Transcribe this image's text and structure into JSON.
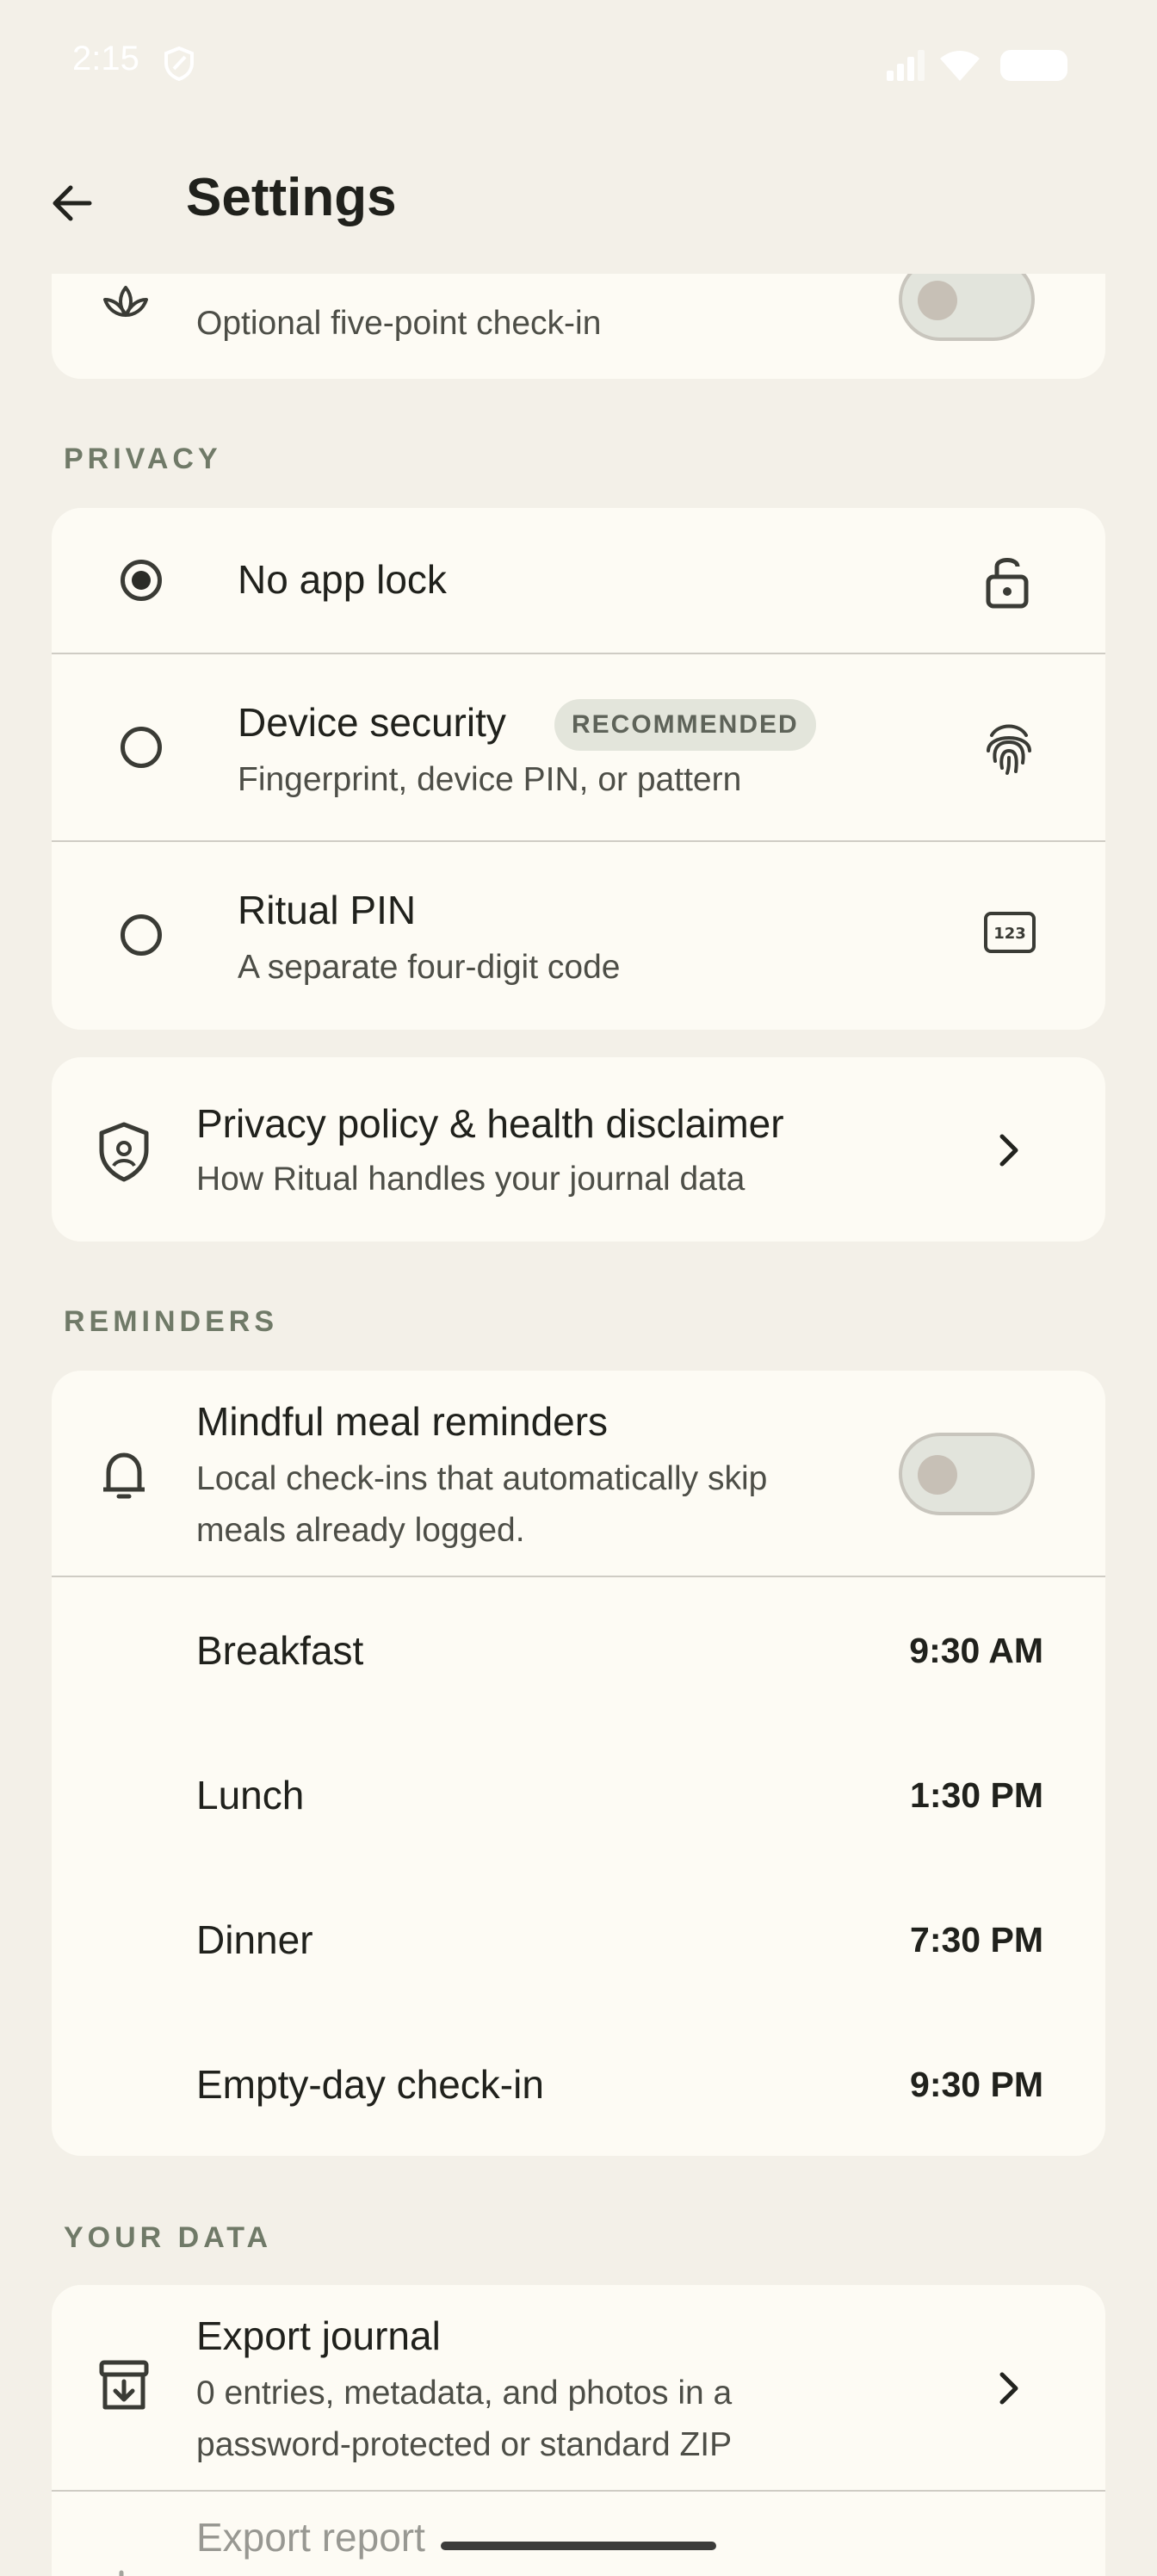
{
  "status_bar": {
    "time": "2:15"
  },
  "app_bar": {
    "title": "Settings"
  },
  "top_card": {
    "subtitle": "Optional five-point check-in"
  },
  "privacy": {
    "section_label": "PRIVACY",
    "options": [
      {
        "title": "No app lock",
        "subtitle": "",
        "selected": true
      },
      {
        "title": "Device security",
        "badge": "RECOMMENDED",
        "subtitle": "Fingerprint, device PIN, or pattern",
        "selected": false
      },
      {
        "title": "Ritual PIN",
        "subtitle": "A separate four-digit code",
        "selected": false
      }
    ],
    "policy": {
      "title": "Privacy policy & health disclaimer",
      "subtitle": "How Ritual handles your journal data"
    }
  },
  "reminders": {
    "section_label": "REMINDERS",
    "toggle": {
      "title": "Mindful meal reminders",
      "subtitle_line1": "Local check-ins that automatically skip",
      "subtitle_line2": "meals already logged.",
      "enabled": false
    },
    "items": [
      {
        "label": "Breakfast",
        "time": "9:30 AM"
      },
      {
        "label": "Lunch",
        "time": "1:30 PM"
      },
      {
        "label": "Dinner",
        "time": "7:30 PM"
      },
      {
        "label": "Empty-day check-in",
        "time": "9:30 PM"
      }
    ]
  },
  "your_data": {
    "section_label": "YOUR DATA",
    "export_journal": {
      "title": "Export journal",
      "subtitle_line1": "0 entries, metadata, and photos in a",
      "subtitle_line2": "password-protected or standard ZIP"
    },
    "export_report": {
      "title": "Export report"
    }
  },
  "colors": {
    "background": "#f3f0e8",
    "card": "#fdfbf4",
    "section_label": "#707a68",
    "badge_bg": "#e3e5db"
  }
}
